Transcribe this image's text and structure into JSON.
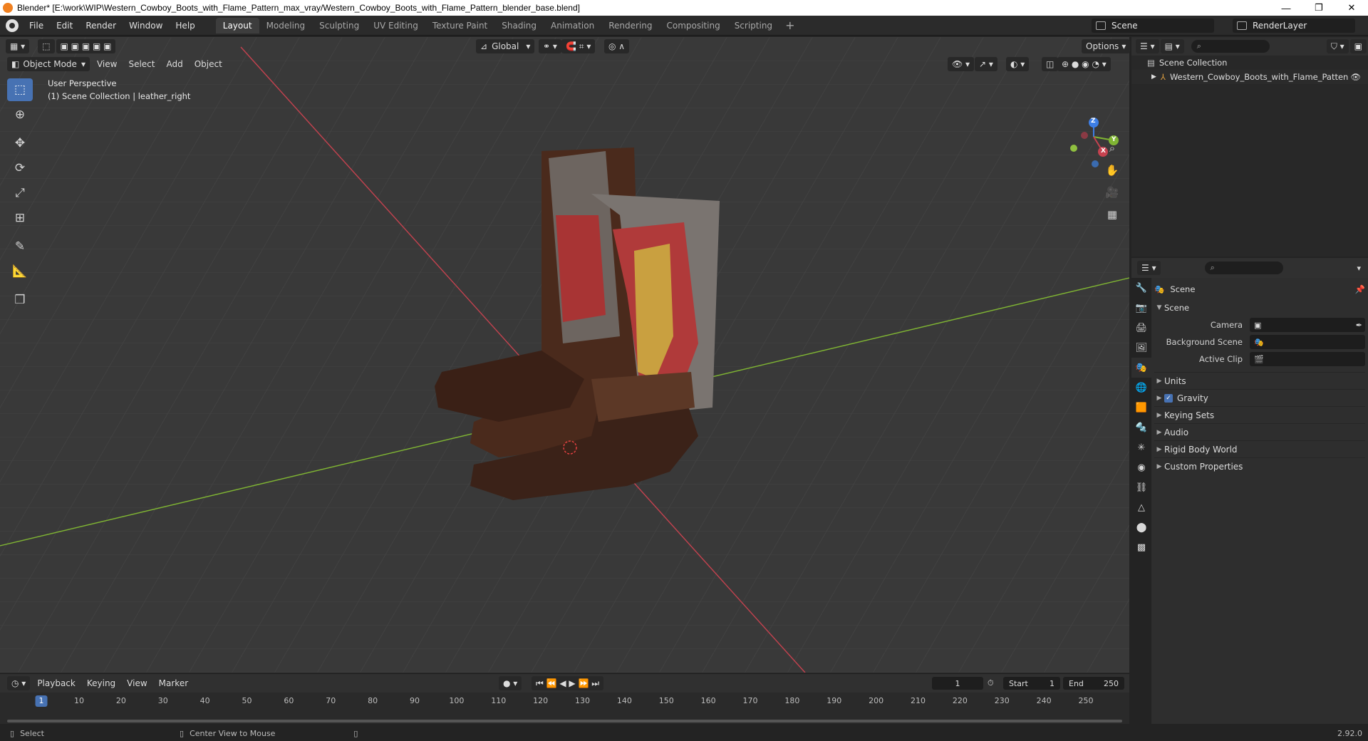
{
  "window": {
    "title": "Blender* [E:\\work\\WIP\\Western_Cowboy_Boots_with_Flame_Pattern_max_vray/Western_Cowboy_Boots_with_Flame_Pattern_blender_base.blend]",
    "minimize": "—",
    "maximize": "❐",
    "close": "✕"
  },
  "menu": [
    "File",
    "Edit",
    "Render",
    "Window",
    "Help"
  ],
  "workspaces": [
    "Layout",
    "Modeling",
    "Sculpting",
    "UV Editing",
    "Texture Paint",
    "Shading",
    "Animation",
    "Rendering",
    "Compositing",
    "Scripting"
  ],
  "active_workspace": "Layout",
  "scene_name": "Scene",
  "view_layer": "RenderLayer",
  "viewport": {
    "mode": "Object Mode",
    "menus": [
      "View",
      "Select",
      "Add",
      "Object"
    ],
    "transform_orientation": "Global",
    "options_label": "Options",
    "perspective": "User Perspective",
    "collection_info": "(1) Scene Collection | leather_right",
    "gizmo": {
      "x": "X",
      "y": "Y",
      "z": "Z"
    }
  },
  "outliner": {
    "root": "Scene Collection",
    "items": [
      "Western_Cowboy_Boots_with_Flame_Patten"
    ]
  },
  "properties": {
    "context": "Scene",
    "section": "Scene",
    "fields": [
      {
        "label": "Camera",
        "value": ""
      },
      {
        "label": "Background Scene",
        "value": ""
      },
      {
        "label": "Active Clip",
        "value": ""
      }
    ],
    "panels": [
      "Units",
      "Gravity",
      "Keying Sets",
      "Audio",
      "Rigid Body World",
      "Custom Properties"
    ],
    "gravity_checked": true
  },
  "timeline": {
    "menus": [
      "Playback",
      "Keying",
      "View",
      "Marker"
    ],
    "current_frame": "1",
    "start_label": "Start",
    "start": "1",
    "end_label": "End",
    "end": "250",
    "ticks": [
      "1",
      "10",
      "20",
      "30",
      "40",
      "50",
      "60",
      "70",
      "80",
      "90",
      "100",
      "110",
      "120",
      "130",
      "140",
      "150",
      "160",
      "170",
      "180",
      "190",
      "200",
      "210",
      "220",
      "230",
      "240",
      "250"
    ]
  },
  "status": {
    "left": "Select",
    "middle": "Center View to Mouse",
    "version": "2.92.0"
  },
  "colors": {
    "accent": "#4772b3",
    "x_axis": "#c5424f",
    "y_axis": "#7fb433",
    "z_axis": "#3d7ee5",
    "viewport_bg": "#393939"
  }
}
